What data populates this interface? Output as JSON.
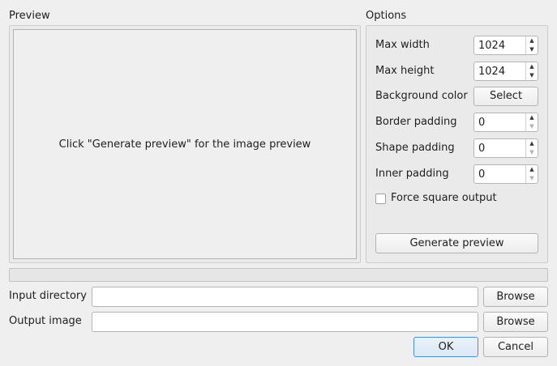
{
  "preview": {
    "section_title": "Preview",
    "placeholder": "Click \"Generate preview\" for the image preview"
  },
  "options": {
    "section_title": "Options",
    "max_width": {
      "label": "Max width",
      "value": "1024"
    },
    "max_height": {
      "label": "Max height",
      "value": "1024"
    },
    "background_color": {
      "label": "Background color",
      "button_label": "Select"
    },
    "border_padding": {
      "label": "Border padding",
      "value": "0"
    },
    "shape_padding": {
      "label": "Shape padding",
      "value": "0"
    },
    "inner_padding": {
      "label": "Inner padding",
      "value": "0"
    },
    "force_square": {
      "label": "Force square output",
      "checked": false
    },
    "generate_button_label": "Generate preview"
  },
  "progress": {
    "value": 0
  },
  "input_directory": {
    "label": "Input directory",
    "value": "",
    "browse_label": "Browse"
  },
  "output_image": {
    "label": "Output image",
    "value": "",
    "browse_label": "Browse"
  },
  "dialog_buttons": {
    "ok_label": "OK",
    "cancel_label": "Cancel"
  },
  "icons": {
    "spin_up": "triangle-up-icon",
    "spin_down": "triangle-down-icon"
  },
  "colors": {
    "default_button_border": "#4a90d9",
    "window_background": "#efefef"
  }
}
